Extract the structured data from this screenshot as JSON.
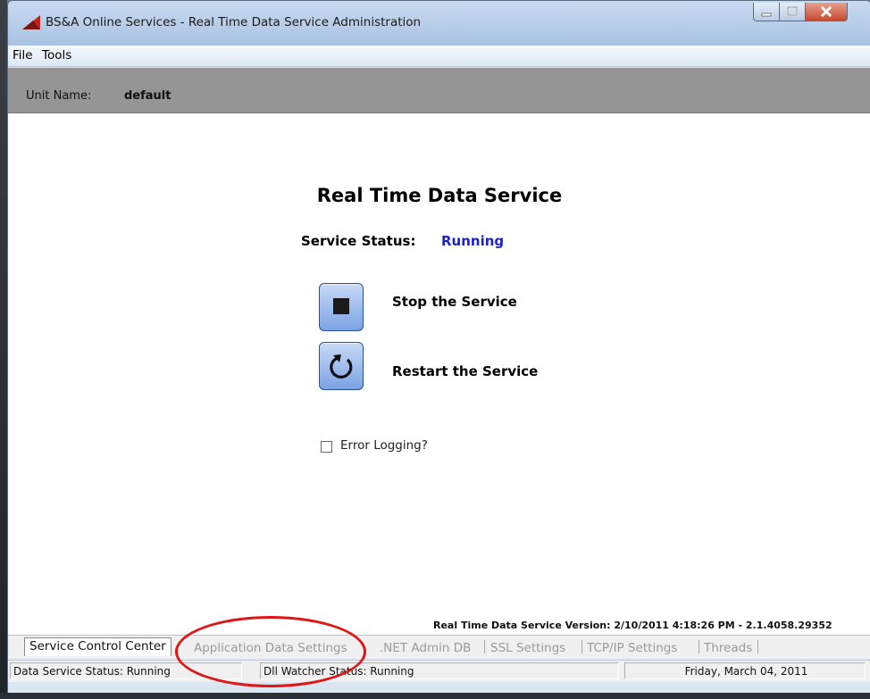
{
  "window": {
    "title": "BS&A Online Services - Real Time Data Service Administration",
    "controls": {
      "min": "minimize",
      "max": "maximize",
      "close": "close"
    }
  },
  "menu": {
    "file": "File",
    "tools": "Tools"
  },
  "unit": {
    "label": "Unit Name:",
    "value": "default"
  },
  "service": {
    "title": "Real Time Data Service",
    "status_label": "Service Status:",
    "status_value": "Running",
    "stop_label": "Stop the Service",
    "restart_label": "Restart the Service",
    "error_logging_label": "Error Logging?",
    "error_logging_checked": false,
    "version": "Real Time Data Service Version: 2/10/2011 4:18:26 PM - 2.1.4058.29352"
  },
  "tabs": [
    "Service Control Center",
    "Application Data Settings",
    ".NET Admin DB",
    "SSL Settings",
    "TCP/IP Settings",
    "Threads"
  ],
  "status_bar": {
    "data_service": "Data Service Status:  Running",
    "watcher": "Dll Watcher Status: Running",
    "date": "Friday, March 04, 2011"
  },
  "colors": {
    "status_running": "#1c22c8",
    "annotation_ellipse": "#e01515",
    "button_fill": "#7ca2e4"
  }
}
